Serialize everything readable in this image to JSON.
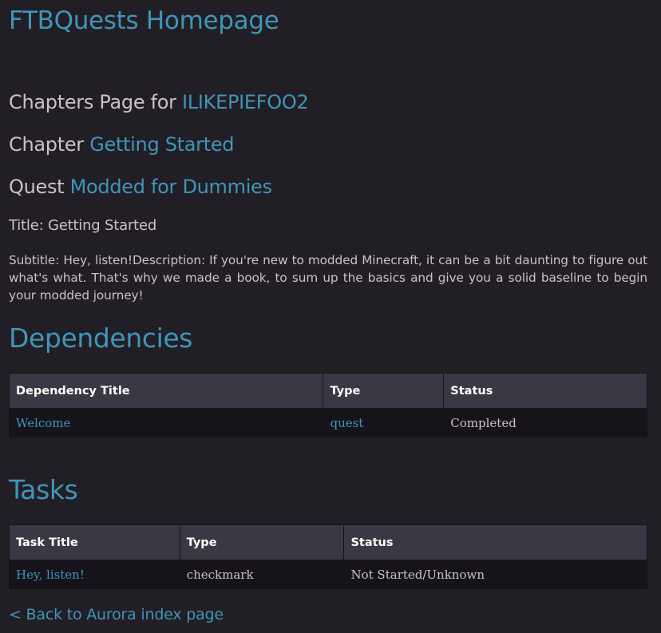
{
  "header": {
    "title": "FTBQuests Homepage"
  },
  "breadcrumbs": {
    "chapters_prefix": "Chapters Page for ",
    "chapters_user": "ILIKEPIEFOO2",
    "chapter_prefix": "Chapter ",
    "chapter_name": "Getting Started",
    "quest_prefix": "Quest ",
    "quest_name": "Modded for Dummies"
  },
  "quest": {
    "title": "Title: Getting Started",
    "description": "Subtitle: Hey, listen!Description: If you're new to modded Minecraft, it can be a bit daunting to figure out what's what. That's why we made a book, to sum up the basics and give you a solid baseline to begin your modded journey!"
  },
  "dependencies": {
    "heading": "Dependencies",
    "columns": [
      "Dependency Title",
      "Type",
      "Status"
    ],
    "rows": [
      {
        "title": "Welcome",
        "type": "quest",
        "status": "Completed"
      }
    ]
  },
  "tasks": {
    "heading": "Tasks",
    "columns": [
      "Task Title",
      "Type",
      "Status"
    ],
    "rows": [
      {
        "title": "Hey, listen!",
        "type": "checkmark",
        "status": "Not Started/Unknown"
      }
    ]
  },
  "footer": {
    "back_link": "< Back to Aurora index page"
  },
  "colors": {
    "background": "#221e25",
    "link": "#3f96b8",
    "text": "#c9c2c9",
    "table_header": "#3a3844",
    "table_row": "#16141a"
  }
}
